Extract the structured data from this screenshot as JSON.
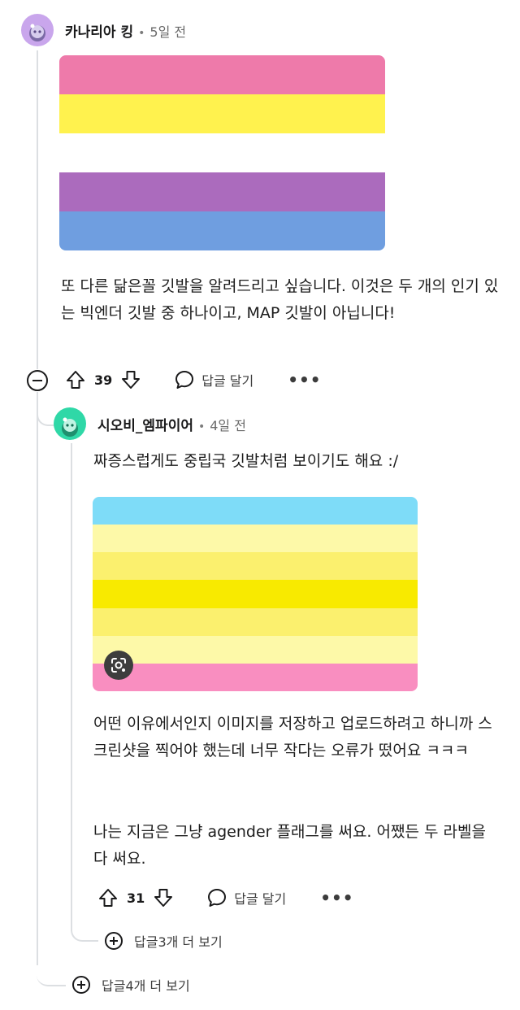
{
  "comment1": {
    "author": "카나리아 킹",
    "time": "5일 전",
    "flag_colors": [
      "#ee7aaa",
      "#fff24e",
      "#ffffff",
      "#ab6bbd",
      "#6f9ee0"
    ],
    "text": "또 다른 닮은꼴 깃발을 알려드리고 싶습니다. 이것은 두 개의 인기 있는 빅엔더 깃발 중 하나이고, MAP 깃발이 아닙니다!",
    "votes": "39",
    "reply_label": "답글 달기",
    "more_label": "•••"
  },
  "comment2": {
    "author": "시오비_엠파이어",
    "time": "4일 전",
    "text1": "짜증스럽게도 중립국 깃발처럼 보이기도 해요 :/",
    "flag_colors": [
      "#7edcf8",
      "#fdf9a8",
      "#fbf06e",
      "#f8ea00",
      "#fbf06e",
      "#fdf9a8",
      "#f98ec0"
    ],
    "text2": "어떤 이유에서인지 이미지를 저장하고 업로드하려고 하니까 스크린샷을 찍어야 했는데 너무 작다는 오류가 떴어요 ㅋㅋㅋ",
    "text3": "나는 지금은 그냥 agender 플래그를 써요. 어쨌든 두 라벨을 다 써요.",
    "votes": "31",
    "reply_label": "답글 달기",
    "more_label": "•••",
    "more_replies": "답글3개 더 보기"
  },
  "more_replies_root": "답글4개 더 보기",
  "colors": {
    "avatar1": "#c9a6ec",
    "avatar2": "#2fd8a7"
  }
}
